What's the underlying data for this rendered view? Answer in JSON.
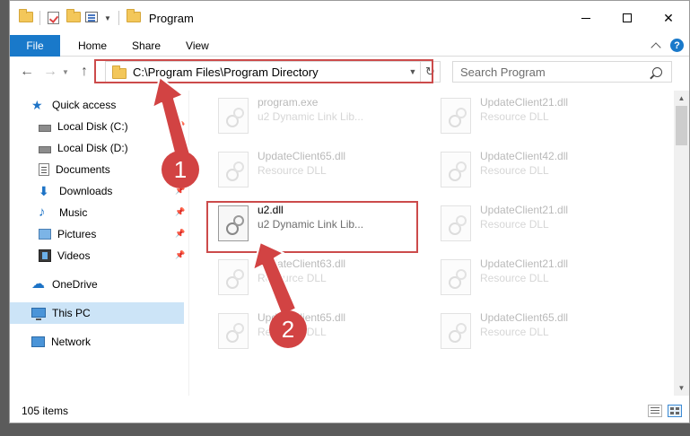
{
  "window": {
    "title": "Program",
    "controls": {
      "minimize": "minimize",
      "maximize": "maximize",
      "close": "✕"
    }
  },
  "ribbon": {
    "tabs": [
      "File",
      "Home",
      "Share",
      "View"
    ],
    "help": "?"
  },
  "navbar": {
    "address": "C:\\Program Files\\Program Directory",
    "search_placeholder": "Search Program"
  },
  "sidebar": {
    "items": [
      {
        "label": "Quick access",
        "icon": "star-icon",
        "pinned": false
      },
      {
        "label": "Local Disk (C:)",
        "icon": "disk-icon",
        "pinned": true
      },
      {
        "label": "Local Disk (D:)",
        "icon": "disk-icon",
        "pinned": false
      },
      {
        "label": "Documents",
        "icon": "documents-icon",
        "pinned": true
      },
      {
        "label": "Downloads",
        "icon": "downloads-icon",
        "pinned": true
      },
      {
        "label": "Music",
        "icon": "music-icon",
        "pinned": true
      },
      {
        "label": "Pictures",
        "icon": "pictures-icon",
        "pinned": true
      },
      {
        "label": "Videos",
        "icon": "videos-icon",
        "pinned": true
      },
      {
        "label": "OneDrive",
        "icon": "onedrive-icon",
        "pinned": false
      },
      {
        "label": "This PC",
        "icon": "this-pc-icon",
        "pinned": false,
        "selected": true
      },
      {
        "label": "Network",
        "icon": "network-icon",
        "pinned": false
      }
    ]
  },
  "files": [
    {
      "name": "program.exe",
      "type": "u2 Dynamic Link Lib..."
    },
    {
      "name": "UpdateClient21.dll",
      "type": "Resource DLL"
    },
    {
      "name": "UpdateClient65.dll",
      "type": "Resource DLL"
    },
    {
      "name": "UpdateClient42.dll",
      "type": "Resource DLL"
    },
    {
      "name": "u2.dll",
      "type": "u2 Dynamic Link Lib...",
      "highlighted": true
    },
    {
      "name": "UpdateClient21.dll",
      "type": "Resource DLL"
    },
    {
      "name": "UpdateClient63.dll",
      "type": "Resource DLL"
    },
    {
      "name": "UpdateClient21.dll",
      "type": "Resource DLL"
    },
    {
      "name": "UpdateClient65.dll",
      "type": "Resource DLL"
    },
    {
      "name": "UpdateClient65.dll",
      "type": "Resource DLL"
    }
  ],
  "status": {
    "items": "105 items"
  },
  "annotations": {
    "step1": "1",
    "step2": "2",
    "color": "#d24343"
  }
}
